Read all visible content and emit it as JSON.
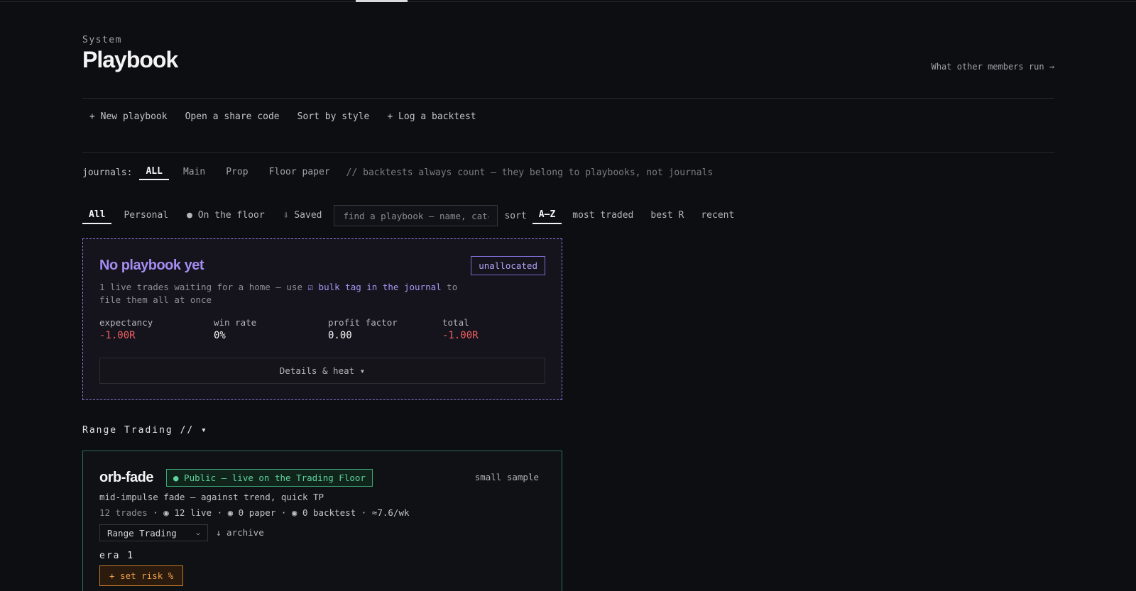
{
  "header": {
    "eyebrow": "System",
    "title": "Playbook",
    "other_link": "What other members run →"
  },
  "actions": [
    "+ New playbook",
    "Open a share code",
    "Sort by style",
    "+ Log a backtest"
  ],
  "journals": {
    "label": "journals:",
    "options": [
      "ALL",
      "Main",
      "Prop",
      "Floor paper"
    ],
    "active": "ALL",
    "note": "// backtests always count — they belong to playbooks, not journals"
  },
  "filters": {
    "tabs": [
      "All",
      "Personal",
      "● On the floor",
      "⇩ Saved"
    ],
    "active": "All",
    "search_placeholder": "find a playbook — name, category",
    "sort_label": "sort",
    "sort_options": [
      "A–Z",
      "most traded",
      "best R",
      "recent"
    ],
    "sort_active": "A–Z"
  },
  "unallocated_card": {
    "title": "No playbook yet",
    "badge": "unallocated",
    "desc_pre": "1 live trades waiting for a home — use ",
    "desc_link": "☑ bulk tag in the journal",
    "desc_post": " to file them all at once",
    "stats": [
      {
        "label": "expectancy",
        "value": "-1.00R",
        "negative": true
      },
      {
        "label": "win rate",
        "value": "0%",
        "negative": false
      },
      {
        "label": "profit factor",
        "value": "0.00",
        "negative": false
      },
      {
        "label": "total",
        "value": "-1.00R",
        "negative": true
      }
    ],
    "details_button": "Details & heat ▾"
  },
  "group": {
    "heading": "Range Trading // ▾"
  },
  "playbook_card": {
    "name": "orb-fade",
    "public_badge": "● Public — live on the Trading Floor",
    "sample_note": "small sample",
    "subtitle": "mid-impulse fade — against trend, quick TP",
    "trades": "12 trades",
    "meta_rest": " · ◉ 12 live · ◉ 0 paper · ◉ 0 backtest · ≈7.6/wk",
    "category_select": "Range Trading",
    "archive": "↓ archive",
    "era": "era 1",
    "risk_button": "+ set risk %"
  },
  "colors": {
    "background": "#0d0e12",
    "accent_purple": "#a48cf2",
    "public_green": "#5ed39b",
    "negative_red": "#ef5f5f",
    "risk_orange": "#f0a04b"
  }
}
